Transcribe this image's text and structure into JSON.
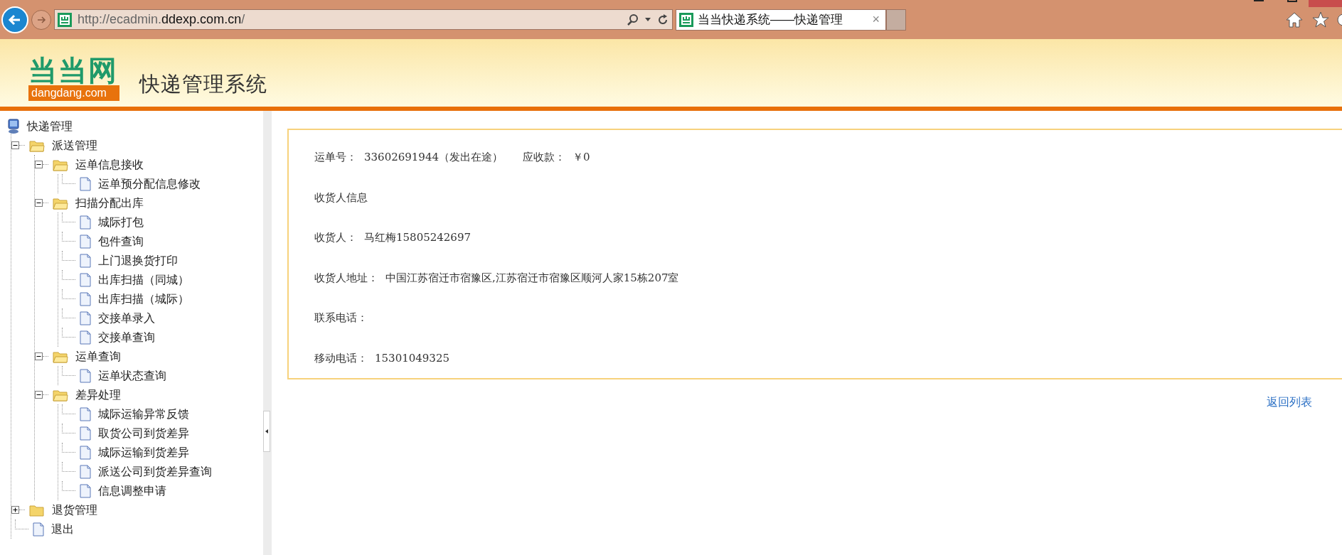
{
  "browser": {
    "url": {
      "before": "http://ecadmin.",
      "domain": "ddexp.com.cn",
      "after": "/"
    },
    "tabs": [
      {
        "title": "当当快递系统——快递管理",
        "selected": true,
        "close": "×"
      }
    ]
  },
  "header": {
    "logo": {
      "name": "当当网",
      "domain": "dangdang.com"
    },
    "title": "快递管理系统"
  },
  "tree": [
    {
      "label": "快递管理",
      "kind": "computer",
      "children": [
        {
          "label": "派送管理",
          "kind": "folder",
          "expanded": true,
          "children": [
            {
              "label": "运单信息接收",
              "kind": "folder",
              "expanded": true,
              "children": [
                {
                  "label": "运单预分配信息修改",
                  "kind": "page"
                }
              ]
            },
            {
              "label": "扫描分配出库",
              "kind": "folder",
              "expanded": true,
              "children": [
                {
                  "label": "城际打包",
                  "kind": "page"
                },
                {
                  "label": "包件查询",
                  "kind": "page"
                },
                {
                  "label": "上门退换货打印",
                  "kind": "page"
                },
                {
                  "label": "出库扫描（同城）",
                  "kind": "page"
                },
                {
                  "label": "出库扫描（城际）",
                  "kind": "page"
                },
                {
                  "label": "交接单录入",
                  "kind": "page"
                },
                {
                  "label": "交接单查询",
                  "kind": "page"
                }
              ]
            },
            {
              "label": "运单查询",
              "kind": "folder",
              "expanded": true,
              "children": [
                {
                  "label": "运单状态查询",
                  "kind": "page"
                }
              ]
            },
            {
              "label": "差异处理",
              "kind": "folder",
              "expanded": true,
              "children": [
                {
                  "label": "城际运输异常反馈",
                  "kind": "page"
                },
                {
                  "label": "取货公司到货差异",
                  "kind": "page"
                },
                {
                  "label": "城际运输到货差异",
                  "kind": "page"
                },
                {
                  "label": "派送公司到货差异查询",
                  "kind": "page"
                },
                {
                  "label": "信息调整申请",
                  "kind": "page"
                }
              ]
            }
          ]
        },
        {
          "label": "退货管理",
          "kind": "folder",
          "expanded": false
        },
        {
          "label": "退出",
          "kind": "page"
        }
      ]
    }
  ],
  "detail": {
    "rows": [
      {
        "kind": "fields",
        "items": [
          {
            "label": "运单号：",
            "value": "33602691944（发出在途）"
          },
          {
            "label": "应收款：",
            "value": "￥0"
          }
        ]
      },
      {
        "kind": "heading",
        "text": "收货人信息"
      },
      {
        "kind": "fields",
        "items": [
          {
            "label": "收货人：",
            "value": "马红梅15805242697"
          }
        ]
      },
      {
        "kind": "fields",
        "items": [
          {
            "label": "收货人地址：",
            "value": "中国江苏宿迁市宿豫区,江苏宿迁市宿豫区顺河人家15栋207室"
          }
        ]
      },
      {
        "kind": "fields",
        "items": [
          {
            "label": "联系电话："
          }
        ]
      },
      {
        "kind": "fields",
        "items": [
          {
            "label": "移动电话：",
            "value": "15301049325"
          }
        ]
      }
    ],
    "back_link": "返回列表"
  }
}
